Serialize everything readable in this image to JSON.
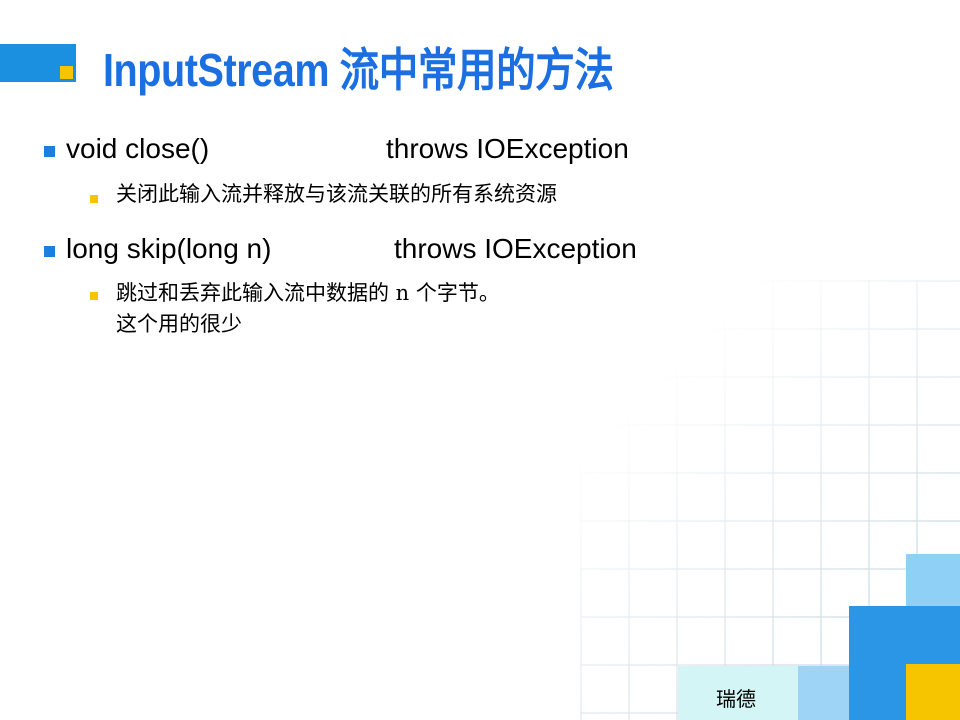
{
  "title": "InputStream 流中常用的方法",
  "methods": [
    {
      "signature": "void close()",
      "throws": "throws IOException",
      "description_lines": [
        "关闭此输入流并释放与该流关联的所有系统资源"
      ]
    },
    {
      "signature": "long skip(long n)",
      "throws": "throws IOException",
      "description_lines": [
        "跳过和丢弃此输入流中数据的 n 个字节。",
        "这个用的很少"
      ]
    }
  ],
  "footer": {
    "label": "瑞德"
  },
  "colors": {
    "accent_blue": "#1b8fe0",
    "accent_yellow": "#f6c500",
    "title_blue": "#1b6fe0"
  }
}
